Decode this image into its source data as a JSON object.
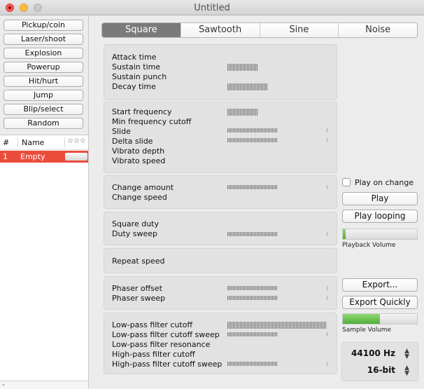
{
  "window": {
    "title": "Untitled"
  },
  "presets": [
    "Pickup/coin",
    "Laser/shoot",
    "Explosion",
    "Powerup",
    "Hit/hurt",
    "Jump",
    "Blip/select",
    "Random"
  ],
  "list": {
    "columns": {
      "number": "#",
      "name": "Name",
      "rating": "☆☆☆"
    },
    "rows": [
      {
        "number": "1",
        "name": "Empty"
      }
    ],
    "footer": {
      "add": "+",
      "remove": "-"
    }
  },
  "tabs": [
    {
      "label": "Square",
      "active": true
    },
    {
      "label": "Sawtooth",
      "active": false
    },
    {
      "label": "Sine",
      "active": false
    },
    {
      "label": "Noise",
      "active": false
    }
  ],
  "groups": [
    {
      "params": [
        "Attack time",
        "Sustain time",
        "Sustain punch",
        "Decay time"
      ]
    },
    {
      "params": [
        "Start frequency",
        "Min frequency cutoff",
        "Slide",
        "Delta slide",
        "Vibrato depth",
        "Vibrato speed"
      ]
    },
    {
      "params": [
        "Change amount",
        "Change speed"
      ]
    },
    {
      "params": [
        "Square duty",
        "Duty sweep"
      ]
    },
    {
      "params": [
        "Repeat speed"
      ]
    },
    {
      "params": [
        "Phaser offset",
        "Phaser sweep"
      ]
    },
    {
      "params": [
        "Low-pass filter cutoff",
        "Low-pass filter cutoff sweep",
        "Low-pass filter resonance",
        "High-pass filter cutoff",
        "High-pass filter cutoff sweep"
      ]
    }
  ],
  "controls": {
    "play_on_change": "Play on change",
    "play": "Play",
    "play_looping": "Play looping",
    "playback_volume_label": "Playback Volume",
    "playback_volume_level": 0.04,
    "export": "Export...",
    "export_quickly": "Export Quickly",
    "sample_volume_label": "Sample Volume",
    "sample_volume_level": 0.5,
    "sample_rate": "44100 Hz",
    "bit_depth": "16-bit"
  },
  "colors": {
    "selection": "#ea4c3c",
    "active_tab": "#7a7a7a",
    "meter_green": "#5cbf45"
  }
}
